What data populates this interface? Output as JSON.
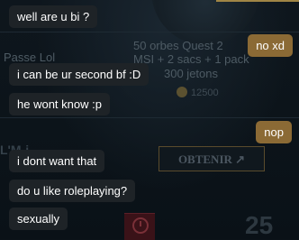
{
  "background": {
    "offer_title": "50 orbes Quest 2",
    "offer_line2": "MSI + 2 sacs + 1 pack",
    "offer_price": "300 jetons",
    "coins": "12500",
    "left_label": "Passe Lol",
    "left_label2": "L'M-i",
    "buy_button": "OBTENIR ↗",
    "counter": "25"
  },
  "chat": {
    "messages": [
      {
        "direction": "incoming",
        "text": "well are u bi ?"
      },
      {
        "direction": "outgoing",
        "text": "no xd"
      },
      {
        "direction": "incoming",
        "text": "i can be ur second bf :D"
      },
      {
        "direction": "incoming",
        "text": "he wont know :p"
      },
      {
        "direction": "outgoing",
        "text": "nop"
      },
      {
        "direction": "incoming",
        "text": "i dont want that"
      },
      {
        "direction": "incoming",
        "text": "do u like roleplaying?"
      },
      {
        "direction": "incoming",
        "text": "sexually"
      }
    ]
  },
  "colors": {
    "incoming_bubble": "#1e2327",
    "outgoing_bubble": "#8b6a35",
    "background": "#0b1218"
  }
}
